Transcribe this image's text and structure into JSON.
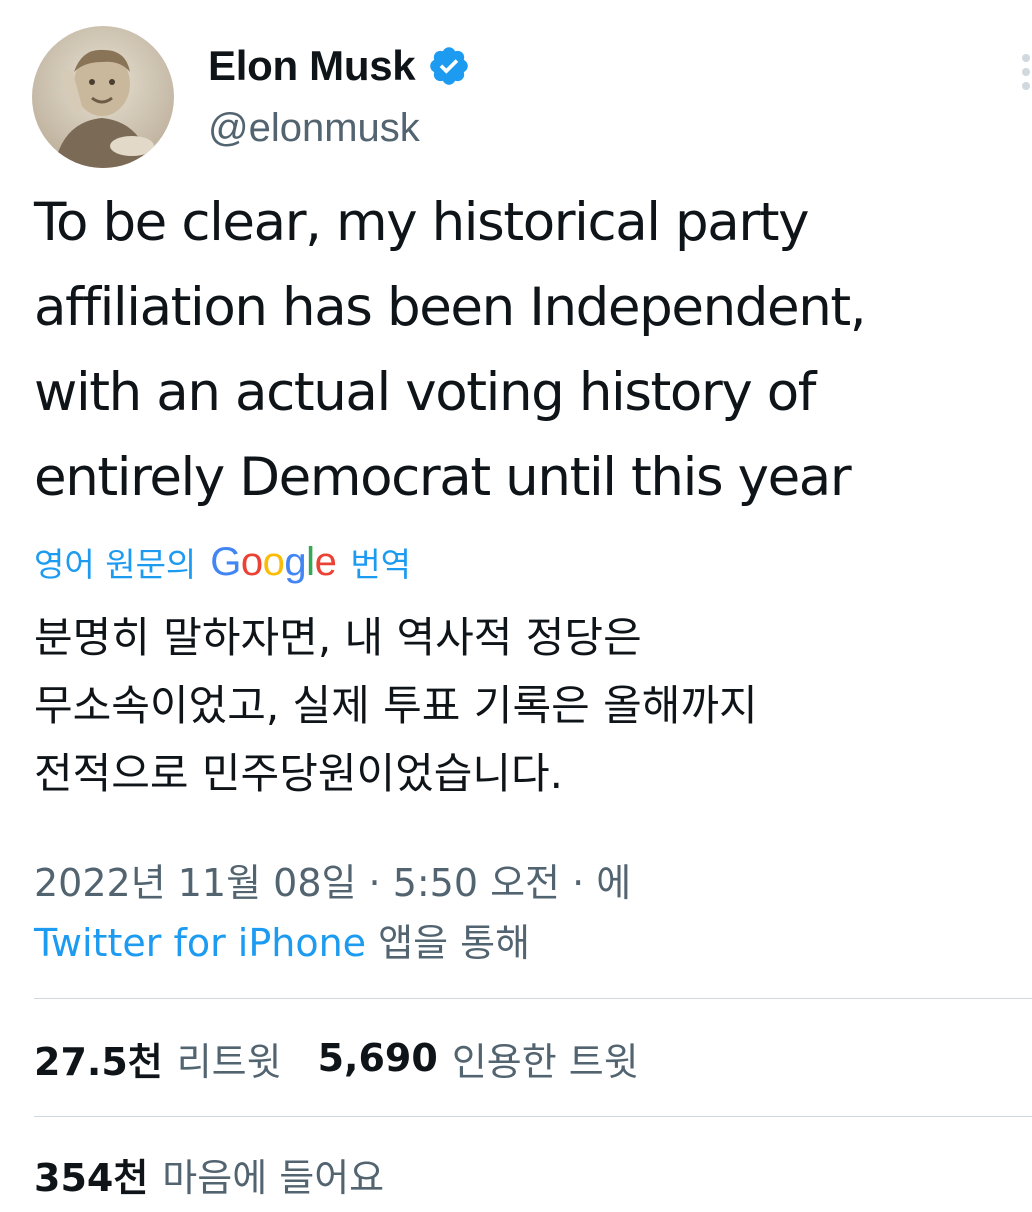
{
  "author": {
    "display_name": "Elon Musk",
    "handle": "@elonmusk",
    "verified": true,
    "avatar_icon": "profile-photo"
  },
  "tweet": {
    "lines": [
      "To be clear, my historical party",
      "affiliation has been Independent,",
      "with an actual voting history of",
      "entirely Democrat until this year"
    ]
  },
  "translation": {
    "prefix": "영어 원문의",
    "provider_letters": [
      "G",
      "o",
      "o",
      "g",
      "l",
      "e"
    ],
    "provider_colors": [
      "#4285F4",
      "#EA4335",
      "#FBBC05",
      "#4285F4",
      "#34A853",
      "#EA4335"
    ],
    "suffix": "번역",
    "lines": [
      "분명히 말하자면, 내 역사적 정당은",
      "무소속이었고, 실제 투표 기록은 올해까지",
      "전적으로 민주당원이었습니다."
    ]
  },
  "meta": {
    "timestamp": "2022년 11월 08일 · 5:50 오전 · 에",
    "source_app": "Twitter for iPhone",
    "source_suffix": " 앱을 통해"
  },
  "stats": {
    "retweets_value": "27.5천",
    "retweets_label": "리트윗",
    "quotes_value": "5,690",
    "quotes_label": "인용한 트윗",
    "likes_value": "354천",
    "likes_label": "마음에 들어요"
  },
  "colors": {
    "link_blue": "#1d9bf0",
    "secondary_text": "#536471",
    "primary_text": "#0f1419",
    "divider": "#cfd9de"
  }
}
